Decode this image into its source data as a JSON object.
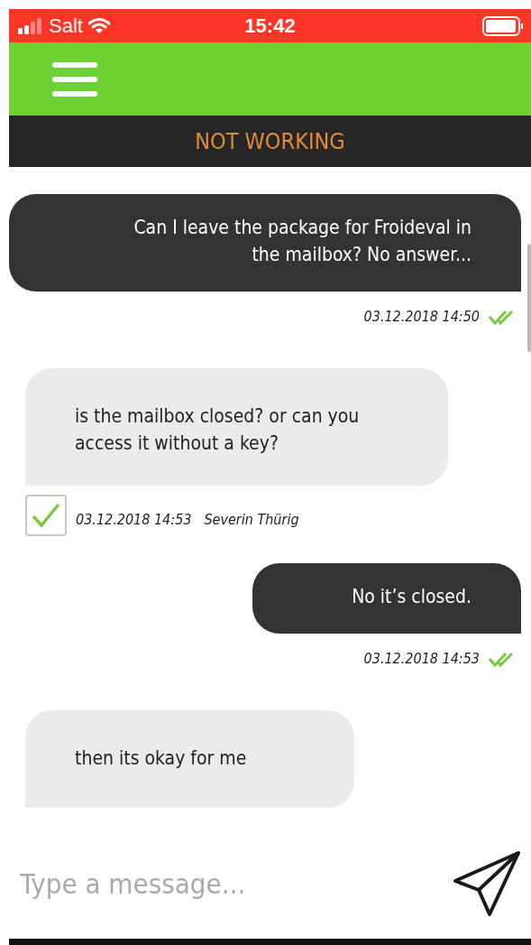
{
  "status_bar": {
    "carrier": "Salt",
    "time": "15:42"
  },
  "header": {
    "title": "NOT WORKING"
  },
  "messages": [
    {
      "kind": "outgoing",
      "text": "Can I leave the package for Froideval in the mailbox? No answer...",
      "timestamp": "03.12.2018 14:50",
      "read": true
    },
    {
      "kind": "incoming",
      "text": "is the mailbox closed? or can you access it without a key?",
      "timestamp": "03.12.2018 14:53",
      "sender": "Severin Thürig",
      "checked": true
    },
    {
      "kind": "outgoing",
      "text": "No it’s closed.",
      "timestamp": "03.12.2018 14:53",
      "read": true
    },
    {
      "kind": "incoming",
      "text": "then its okay for me"
    }
  ],
  "composer": {
    "placeholder": "Type a message..."
  }
}
